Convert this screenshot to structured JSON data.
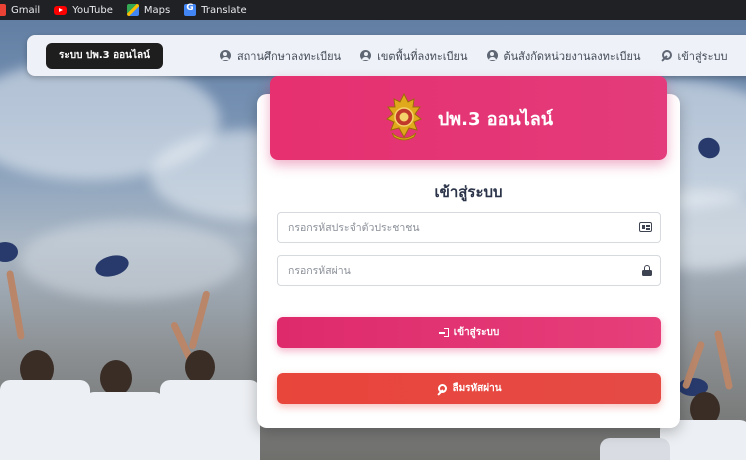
{
  "bookmarks": [
    {
      "label": "Gmail",
      "icon": "gmail-icon"
    },
    {
      "label": "YouTube",
      "icon": "youtube-icon"
    },
    {
      "label": "Maps",
      "icon": "maps-icon"
    },
    {
      "label": "Translate",
      "icon": "translate-icon"
    }
  ],
  "navbar": {
    "brand": "ระบบ ปพ.3 ออนไลน์",
    "links": [
      {
        "label": "สถานศึกษาลงทะเบียน",
        "icon": "user-icon"
      },
      {
        "label": "เขตพื้นที่ลงทะเบียน",
        "icon": "user-icon"
      },
      {
        "label": "ต้นสังกัดหน่วยงานลงทะเบียน",
        "icon": "user-icon"
      },
      {
        "label": "เข้าสู่ระบบ",
        "icon": "key-icon"
      }
    ]
  },
  "card": {
    "header_title": "ปพ.3 ออนไลน์",
    "emblem": "school-emblem-logo",
    "login_title": "เข้าสู่ระบบ",
    "id_placeholder": "กรอกรหัสประจำตัวประชาชน",
    "password_placeholder": "กรอกรหัสผ่าน",
    "login_button": "เข้าสู่ระบบ",
    "forgot_button": "ลืมรหัสผ่าน"
  },
  "colors": {
    "accent_pink": "#e6306f",
    "danger_red": "#e8453b",
    "brand_dark": "#1e1e1e"
  }
}
